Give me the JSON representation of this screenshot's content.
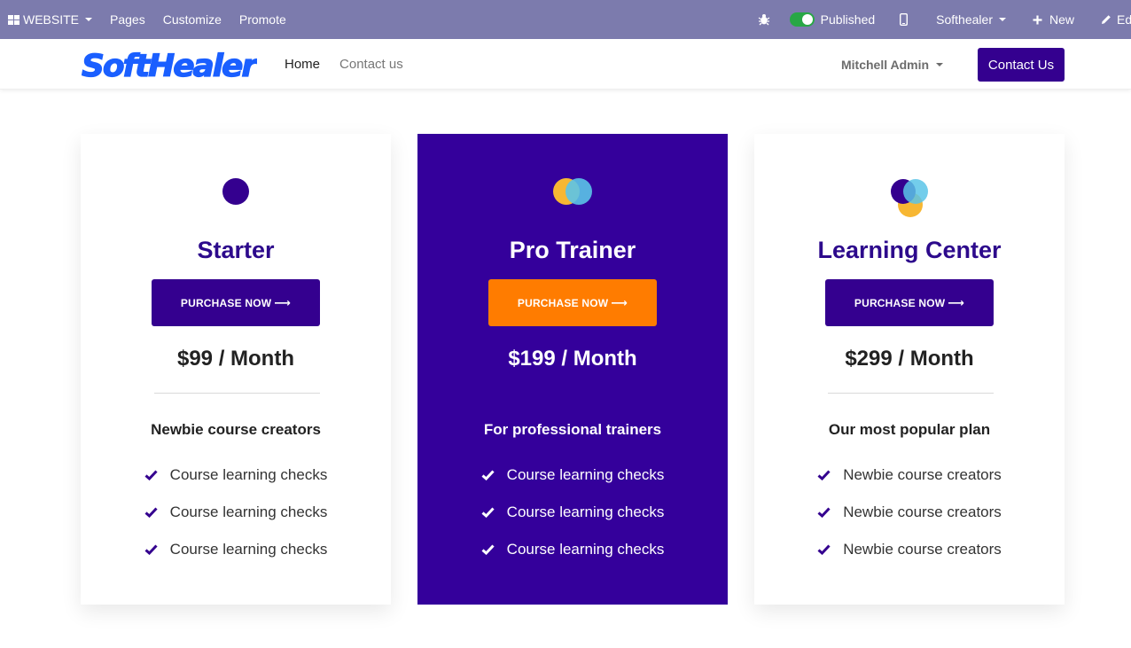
{
  "adminbar": {
    "apps_label": "WEBSITE",
    "menu": [
      "Pages",
      "Customize",
      "Promote"
    ],
    "published_label": "Published",
    "company": "Softhealer",
    "new_label": "New",
    "edit_label": "Edit"
  },
  "header": {
    "logo_text": "SoftHealer",
    "nav": [
      {
        "label": "Home",
        "active": true
      },
      {
        "label": "Contact us",
        "active": false
      }
    ],
    "user": "Mitchell Admin",
    "contact_button": "Contact Us"
  },
  "pricing": {
    "cards": [
      {
        "icon": "single-circle-icon",
        "title": "Starter",
        "button": "PURCHASE NOW",
        "price": "$99 / Month",
        "subtitle": "Newbie course creators",
        "features": [
          "Course learning checks",
          "Course learning checks",
          "Course learning checks"
        ]
      },
      {
        "icon": "two-circles-icon",
        "title": "Pro Trainer",
        "button": "PURCHASE NOW",
        "price": "$199 / Month",
        "subtitle": "For professional trainers",
        "features": [
          "Course learning checks",
          "Course learning checks",
          "Course learning checks"
        ]
      },
      {
        "icon": "three-circles-icon",
        "title": "Learning Center",
        "button": "PURCHASE NOW",
        "price": "$299 / Month",
        "subtitle": "Our most popular plan",
        "features": [
          "Newbie course creators",
          "Newbie course creators",
          "Newbie course creators"
        ]
      }
    ]
  },
  "colors": {
    "admin_bar": "#7c7bad",
    "primary": "#34008f",
    "featured_bg": "#34009b",
    "featured_button": "#ff7c00",
    "logo": "#1a5fff"
  }
}
